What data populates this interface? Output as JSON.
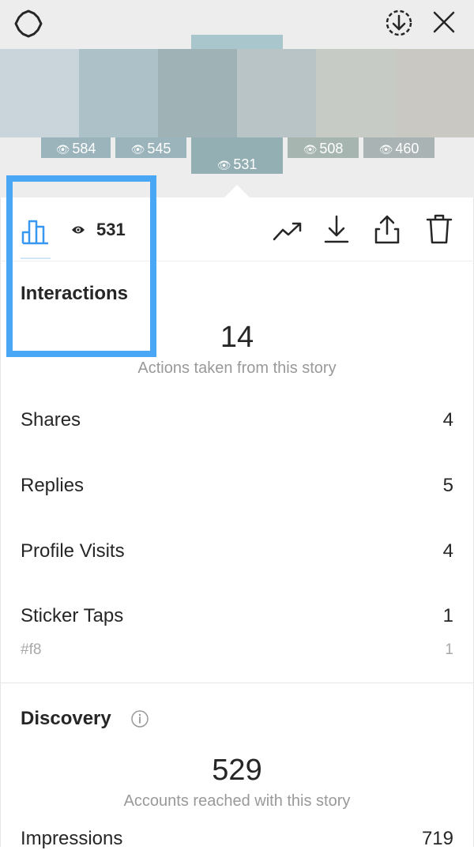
{
  "header": {
    "settings_icon": "gear-icon",
    "download_icon": "download-circle-icon",
    "close_icon": "close-icon"
  },
  "thumbnails": [
    {
      "views": "584"
    },
    {
      "views": "545"
    },
    {
      "views": "531"
    },
    {
      "views": "508"
    },
    {
      "views": "460"
    }
  ],
  "toolbar": {
    "view_count": "531",
    "icons": [
      "bar-chart-icon",
      "eye-icon",
      "trend-icon",
      "download-icon",
      "share-icon",
      "trash-icon"
    ]
  },
  "interactions": {
    "title": "Interactions",
    "total": "14",
    "caption": "Actions taken from this story",
    "rows": [
      {
        "label": "Shares",
        "value": "4"
      },
      {
        "label": "Replies",
        "value": "5"
      },
      {
        "label": "Profile Visits",
        "value": "4"
      },
      {
        "label": "Sticker Taps",
        "value": "1"
      }
    ],
    "sticker_sub": {
      "label": "#f8",
      "value": "1"
    }
  },
  "discovery": {
    "title": "Discovery",
    "total": "529",
    "caption": "Accounts reached with this story",
    "impressions_label": "Impressions",
    "impressions_value": "719"
  },
  "colors": {
    "highlight": "#4aa7f5",
    "accent_blue": "#3897f0"
  }
}
